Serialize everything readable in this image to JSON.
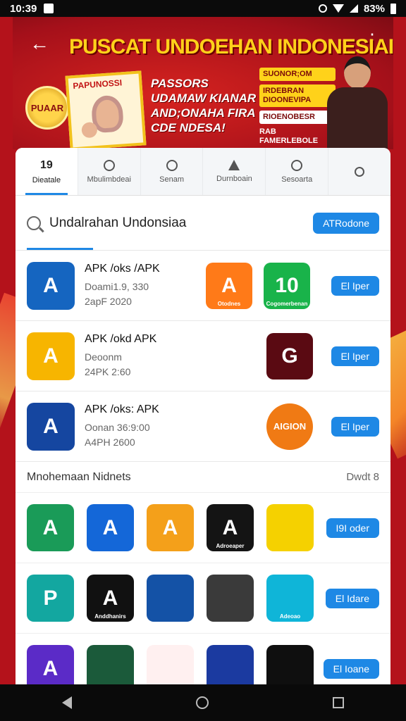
{
  "status_bar": {
    "time": "10:39",
    "battery": "83%"
  },
  "banner": {
    "title": "PUSCAT UNDOEHAN INDONESIAI",
    "coin_label": "PUAAR",
    "card_label": "PAPUNOSSI",
    "text": "PASSORS UDAMAW KIANAR AND;ONAHA FIRA CDE NDESA!",
    "promo_lines": [
      "SUONOR;OM",
      "IRDEBRAN DIOONEVIPA",
      "RIOENOBESR"
    ],
    "promo_footer": "RAB FAMERLEBOLE"
  },
  "tabs": [
    {
      "label": "Dieatale",
      "count": "19",
      "icon": "count",
      "active": true
    },
    {
      "label": "Mbulimbdeai",
      "icon": "user-icon",
      "active": false
    },
    {
      "label": "Senam",
      "icon": "location-icon",
      "active": false
    },
    {
      "label": "Durnboain",
      "icon": "warning-icon",
      "active": false
    },
    {
      "label": "Sesoarta",
      "icon": "person-icon",
      "active": false
    },
    {
      "label": "",
      "icon": "search-icon",
      "active": false
    }
  ],
  "search": {
    "value": "Undalrahan Undonsiaa",
    "button": "ATRodone"
  },
  "apps": [
    {
      "title": "APK /oks /APK",
      "meta1": "Doami1.9, 330",
      "meta2": "2apF 2020",
      "button": "El Iper",
      "icon_color": "#1565c0",
      "extras": [
        {
          "color": "#ff7a18",
          "label": "A",
          "sub": "Otodnes"
        },
        {
          "color": "#19b34a",
          "label": "10",
          "sub": "Cogomerbenan"
        }
      ]
    },
    {
      "title": "APK /okd APK",
      "meta1": "Deoonm",
      "meta2": "24PK 2:60",
      "button": "El Iper",
      "icon_color": "#f7b500",
      "extras": [
        {
          "color": "#5a0a12",
          "label": "G",
          "sub": ""
        }
      ]
    },
    {
      "title": "APK /oks: APK",
      "meta1": "Oonan 36:9:00",
      "meta2": "A4PH 2600",
      "button": "El Iper",
      "icon_color": "#1546a0",
      "extras": [
        {
          "color": "#f07a14",
          "label": "AIGION",
          "sub": ""
        }
      ]
    }
  ],
  "section": {
    "title": "Mnohemaan Nidnets",
    "see_all": "Dwdt 8"
  },
  "grid": [
    {
      "button": "I9I oder",
      "icons": [
        {
          "color": "#1a9b58",
          "label": "A",
          "sub": ""
        },
        {
          "color": "#1467d8",
          "label": "A",
          "sub": ""
        },
        {
          "color": "#f4a01a",
          "label": "A",
          "sub": ""
        },
        {
          "color": "#141414",
          "label": "A",
          "sub": "Adroeaper"
        },
        {
          "color": "#f5d100",
          "label": "",
          "sub": ""
        }
      ]
    },
    {
      "button": "El Idare",
      "icons": [
        {
          "color": "#13a7a0",
          "label": "P",
          "sub": ""
        },
        {
          "color": "#111111",
          "label": "A",
          "sub": "Anddhanirs"
        },
        {
          "color": "#1452a6",
          "label": "",
          "sub": ""
        },
        {
          "color": "#3a3a3a",
          "label": "",
          "sub": ""
        },
        {
          "color": "#0fb5d8",
          "label": "",
          "sub": "Adeoao"
        }
      ]
    },
    {
      "button": "El Ioane",
      "icons": [
        {
          "color": "#5b2bc7",
          "label": "A",
          "sub": ""
        },
        {
          "color": "#1b5a3a",
          "label": "",
          "sub": ""
        },
        {
          "color": "#fff0f0",
          "label": "",
          "sub": ""
        },
        {
          "color": "#1b3aa0",
          "label": "",
          "sub": ""
        },
        {
          "color": "#0f0f0f",
          "label": "",
          "sub": ""
        }
      ]
    }
  ]
}
